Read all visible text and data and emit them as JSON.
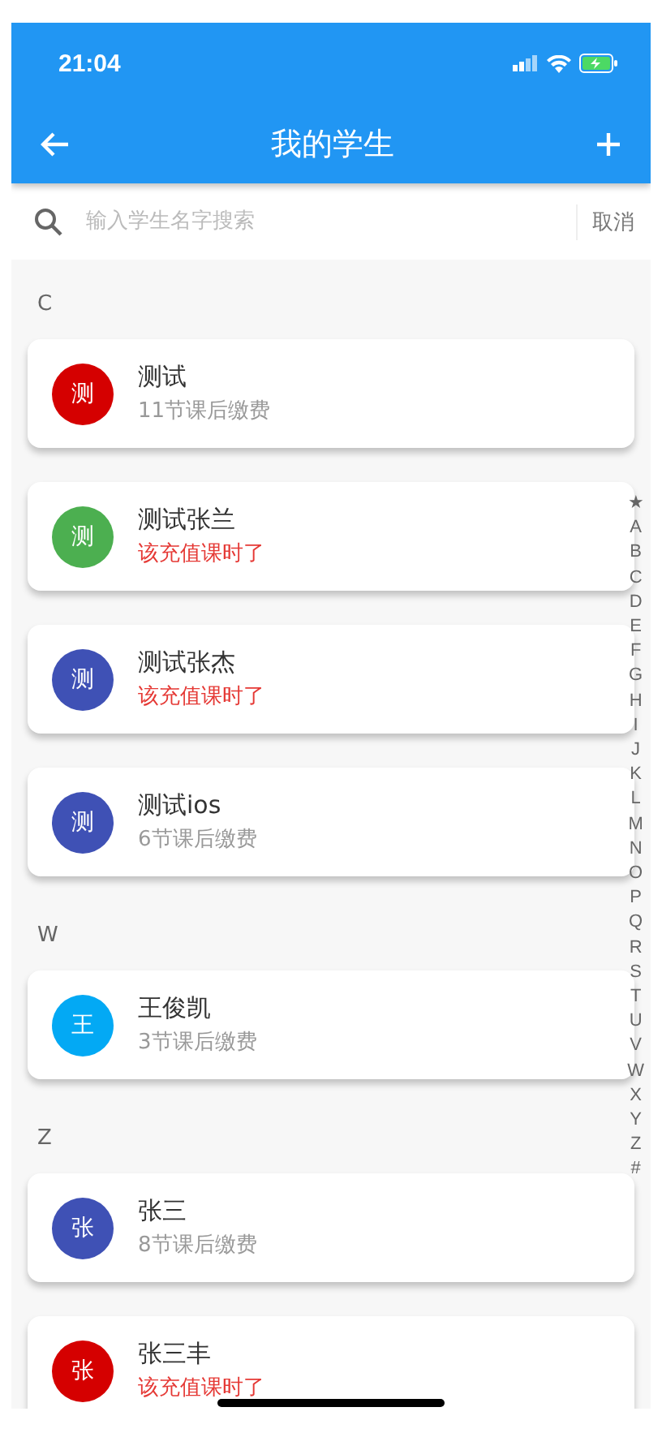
{
  "status_bar": {
    "time": "21:04"
  },
  "app_bar": {
    "title": "我的学生"
  },
  "search": {
    "placeholder": "输入学生名字搜索",
    "cancel": "取消"
  },
  "sections": [
    {
      "letter": "C",
      "students": [
        {
          "avatar": "测",
          "color": "#d50000",
          "name": "测试",
          "note": "11节课后缴费",
          "alert": false
        },
        {
          "avatar": "测",
          "color": "#4caf50",
          "name": "测试张兰",
          "note": "该充值课时了",
          "alert": true
        },
        {
          "avatar": "测",
          "color": "#3f51b5",
          "name": "测试张杰",
          "note": "该充值课时了",
          "alert": true
        },
        {
          "avatar": "测",
          "color": "#3f51b5",
          "name": "测试ios",
          "note": "6节课后缴费",
          "alert": false
        }
      ]
    },
    {
      "letter": "W",
      "students": [
        {
          "avatar": "王",
          "color": "#03a9f4",
          "name": "王俊凯",
          "note": "3节课后缴费",
          "alert": false
        }
      ]
    },
    {
      "letter": "Z",
      "students": [
        {
          "avatar": "张",
          "color": "#3f51b5",
          "name": "张三",
          "note": "8节课后缴费",
          "alert": false
        },
        {
          "avatar": "张",
          "color": "#d50000",
          "name": "张三丰",
          "note": "该充值课时了",
          "alert": true
        }
      ]
    }
  ],
  "index": [
    "★",
    "A",
    "B",
    "C",
    "D",
    "E",
    "F",
    "G",
    "H",
    "I",
    "J",
    "K",
    "L",
    "M",
    "N",
    "O",
    "P",
    "Q",
    "R",
    "S",
    "T",
    "U",
    "V",
    "W",
    "X",
    "Y",
    "Z",
    "#"
  ]
}
